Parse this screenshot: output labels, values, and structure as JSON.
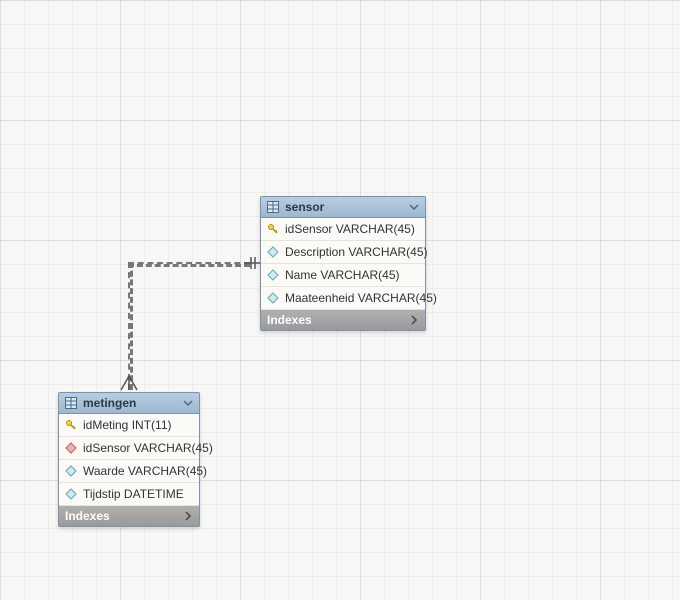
{
  "entities": {
    "sensor": {
      "title": "sensor",
      "columns": [
        {
          "name": "idSensor",
          "type": "VARCHAR(45)",
          "icon": "pk"
        },
        {
          "name": "Description",
          "type": "VARCHAR(45)",
          "icon": "attr"
        },
        {
          "name": "Name",
          "type": "VARCHAR(45)",
          "icon": "attr"
        },
        {
          "name": "Maateenheid",
          "type": "VARCHAR(45)",
          "icon": "attr"
        }
      ],
      "indexes_label": "Indexes"
    },
    "metingen": {
      "title": "metingen",
      "columns": [
        {
          "name": "idMeting",
          "type": "INT(11)",
          "icon": "pk"
        },
        {
          "name": "idSensor",
          "type": "VARCHAR(45)",
          "icon": "fk"
        },
        {
          "name": "Waarde",
          "type": "VARCHAR(45)",
          "icon": "attr"
        },
        {
          "name": "Tijdstip",
          "type": "DATETIME",
          "icon": "attr"
        }
      ],
      "indexes_label": "Indexes"
    }
  },
  "relationship": {
    "from": "metingen.idSensor",
    "to": "sensor.idSensor",
    "style": "dashed",
    "to_cardinality": "one",
    "from_cardinality": "many"
  }
}
